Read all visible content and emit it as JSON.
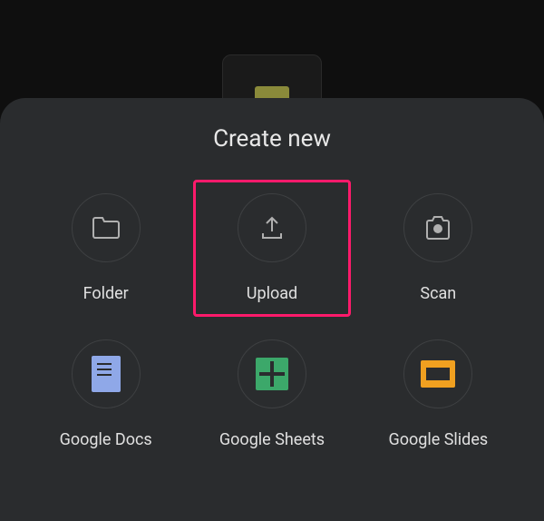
{
  "sheet": {
    "title": "Create new",
    "options": [
      {
        "label": "Folder"
      },
      {
        "label": "Upload"
      },
      {
        "label": "Scan"
      },
      {
        "label": "Google Docs"
      },
      {
        "label": "Google Sheets"
      },
      {
        "label": "Google Slides"
      }
    ],
    "highlighted_option_index": 1
  }
}
